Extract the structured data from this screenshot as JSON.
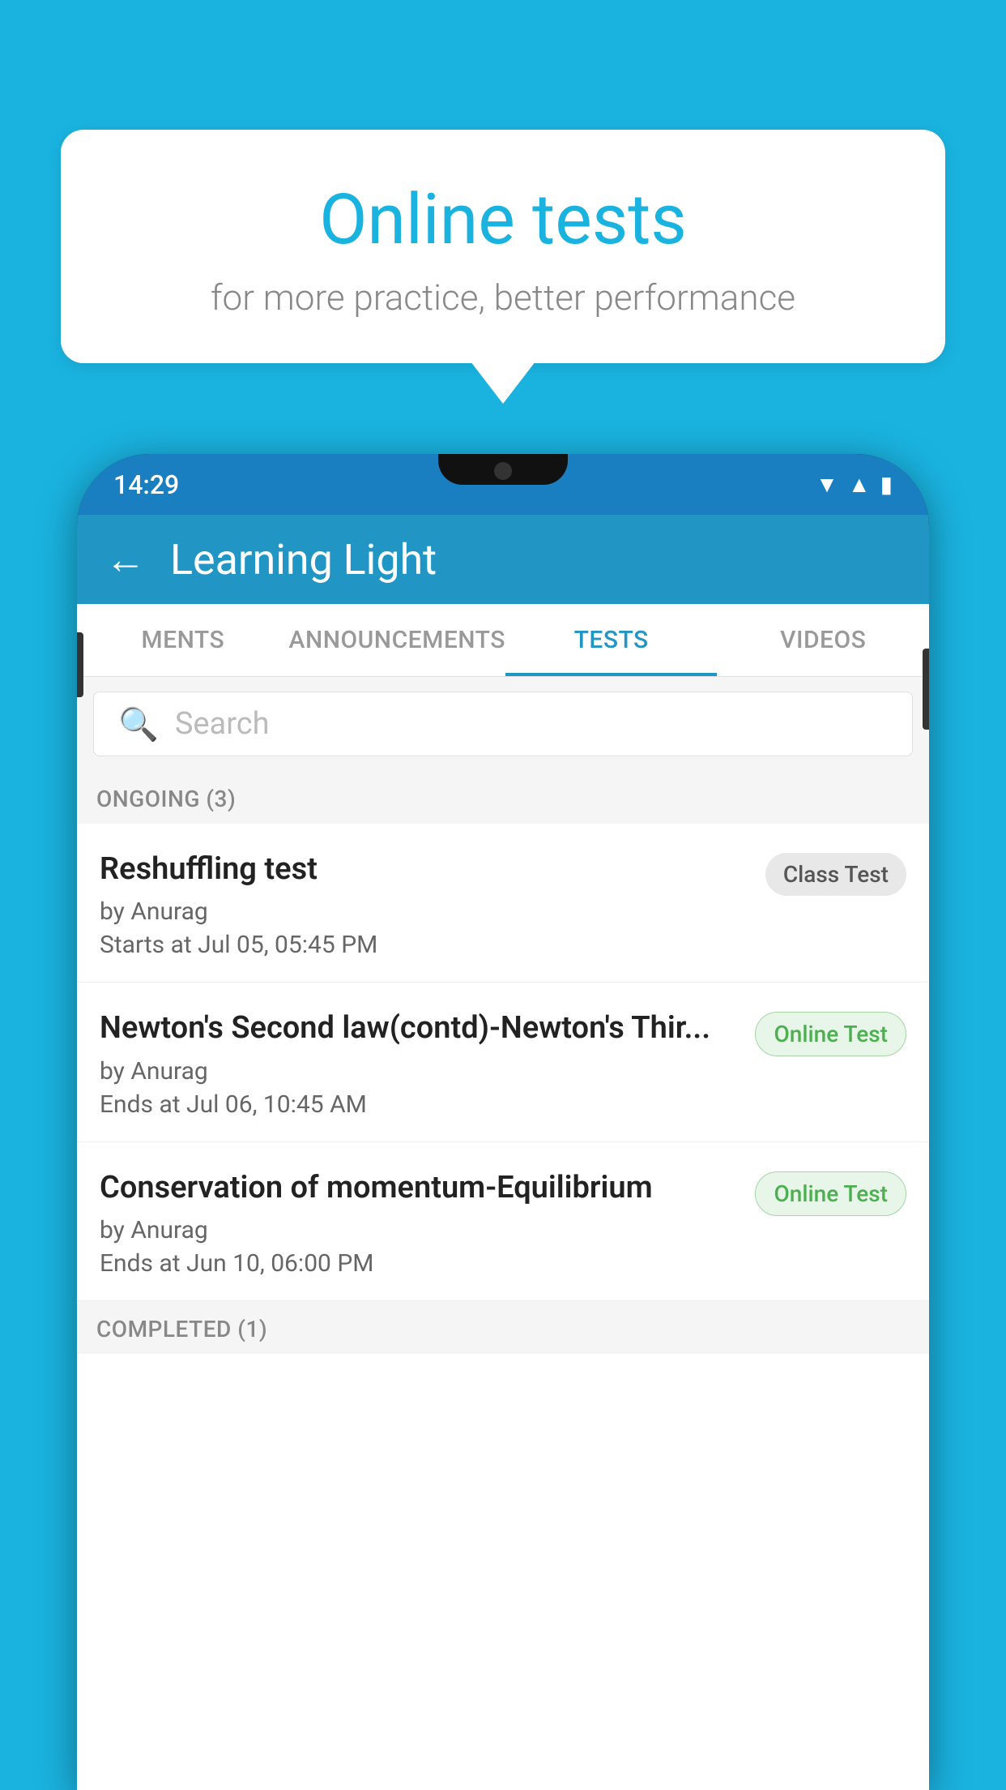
{
  "background": {
    "color": "#1ab3e0"
  },
  "bubble": {
    "title": "Online tests",
    "subtitle": "for more practice, better performance"
  },
  "phone": {
    "status_bar": {
      "time": "14:29"
    },
    "header": {
      "title": "Learning Light",
      "back_label": "←"
    },
    "tabs": [
      {
        "label": "MENTS",
        "active": false
      },
      {
        "label": "ANNOUNCEMENTS",
        "active": false
      },
      {
        "label": "TESTS",
        "active": true
      },
      {
        "label": "VIDEOS",
        "active": false
      }
    ],
    "search": {
      "placeholder": "Search"
    },
    "ongoing_section": {
      "label": "ONGOING (3)"
    },
    "tests": [
      {
        "name": "Reshuffling test",
        "author": "by Anurag",
        "date": "Starts at  Jul 05, 05:45 PM",
        "badge": "Class Test",
        "badge_type": "class"
      },
      {
        "name": "Newton's Second law(contd)-Newton's Thir...",
        "author": "by Anurag",
        "date": "Ends at  Jul 06, 10:45 AM",
        "badge": "Online Test",
        "badge_type": "online"
      },
      {
        "name": "Conservation of momentum-Equilibrium",
        "author": "by Anurag",
        "date": "Ends at  Jun 10, 06:00 PM",
        "badge": "Online Test",
        "badge_type": "online"
      }
    ],
    "completed_section": {
      "label": "COMPLETED (1)"
    }
  }
}
